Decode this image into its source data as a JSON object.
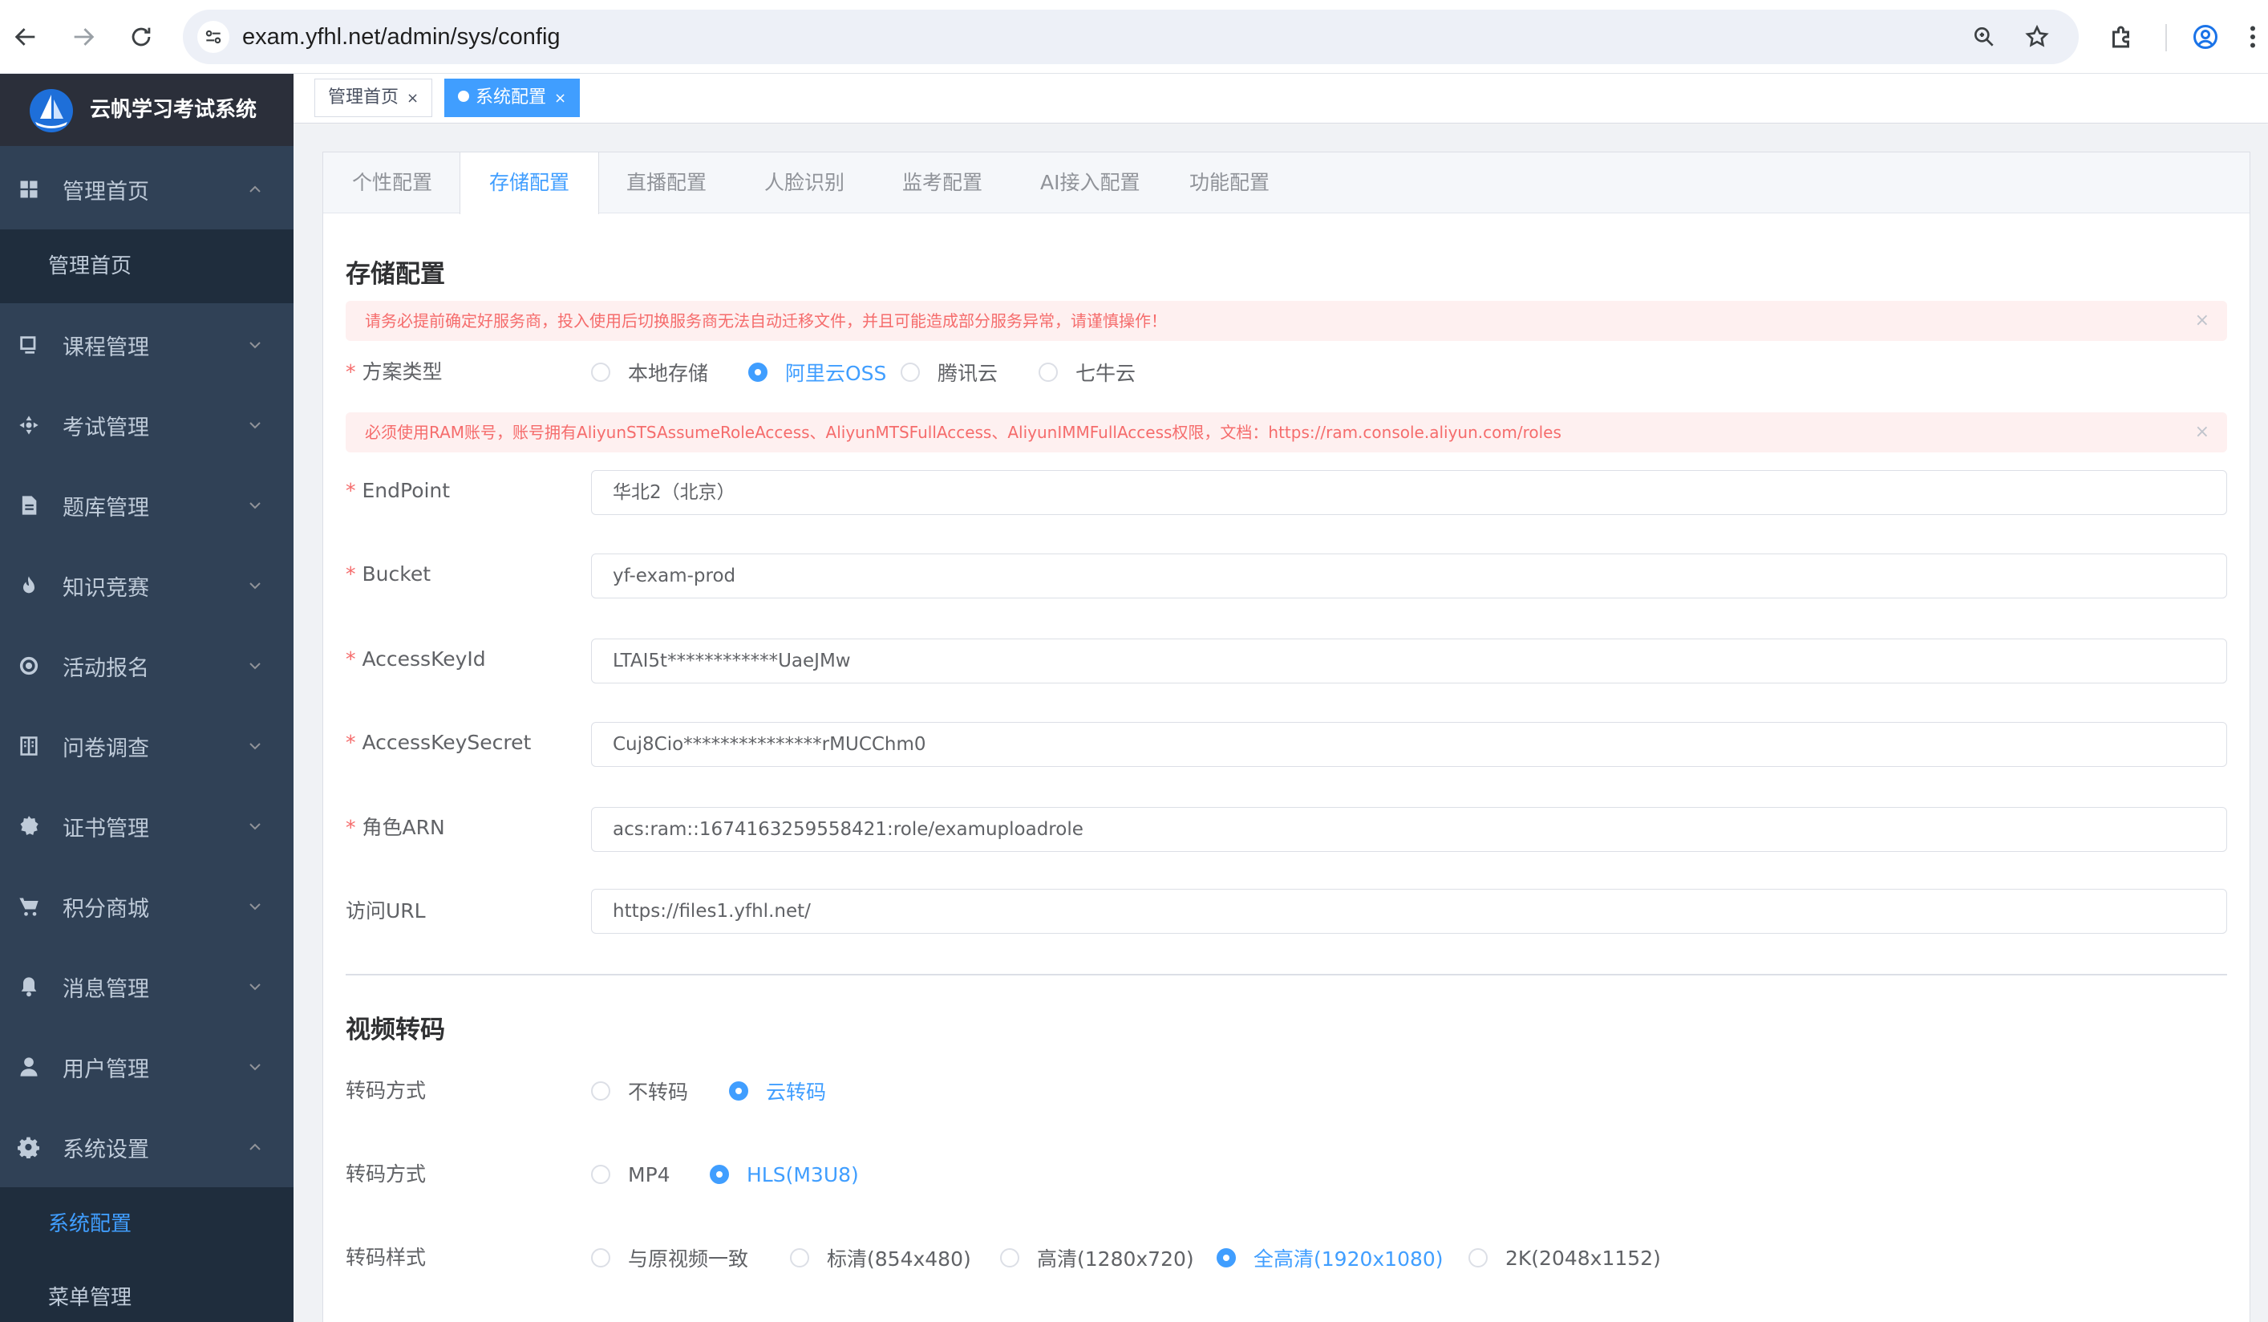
{
  "browser": {
    "url": "exam.yfhl.net/admin/sys/config"
  },
  "sidebar": {
    "app_name": "云帆学习考试系统",
    "menu": [
      {
        "label": "管理首页",
        "icon": "dashboard-icon",
        "expanded": true
      },
      {
        "label": "课程管理",
        "icon": "course-icon",
        "expanded": false
      },
      {
        "label": "考试管理",
        "icon": "exam-icon",
        "expanded": false
      },
      {
        "label": "题库管理",
        "icon": "question-bank-icon",
        "expanded": false
      },
      {
        "label": "知识竞赛",
        "icon": "fire-icon",
        "expanded": false
      },
      {
        "label": "活动报名",
        "icon": "activity-icon",
        "expanded": false
      },
      {
        "label": "问卷调查",
        "icon": "survey-icon",
        "expanded": false
      },
      {
        "label": "证书管理",
        "icon": "certificate-icon",
        "expanded": false
      },
      {
        "label": "积分商城",
        "icon": "cart-icon",
        "expanded": false
      },
      {
        "label": "消息管理",
        "icon": "bell-icon",
        "expanded": false
      },
      {
        "label": "用户管理",
        "icon": "user-icon",
        "expanded": false
      },
      {
        "label": "系统设置",
        "icon": "gear-icon",
        "expanded": true
      }
    ],
    "submenus": {
      "dashboard": [
        "管理首页"
      ],
      "system": [
        "系统配置",
        "菜单管理"
      ]
    }
  },
  "tags": {
    "home": "管理首页",
    "current": "系统配置",
    "close": "×"
  },
  "tabs": [
    "个性配置",
    "存储配置",
    "直播配置",
    "人脸识别",
    "监考配置",
    "AI接入配置",
    "功能配置"
  ],
  "active_tab": "存储配置",
  "storage": {
    "title": "存储配置",
    "warning": "请务必提前确定好服务商，投入使用后切换服务商无法自动迁移文件，并且可能造成部分服务异常，请谨慎操作！",
    "scheme_label": "方案类型",
    "scheme_options": [
      "本地存储",
      "阿里云OSS",
      "腾讯云",
      "七牛云"
    ],
    "scheme_selected": "阿里云OSS",
    "ram_notice": "必须使用RAM账号，账号拥有AliyunSTSAssumeRoleAccess、AliyunMTSFullAccess、AliyunIMMFullAccess权限，文档：https://ram.console.aliyun.com/roles",
    "fields": [
      {
        "label": "EndPoint",
        "value": "华北2（北京）",
        "required": true
      },
      {
        "label": "Bucket",
        "value": "yf-exam-prod",
        "required": true
      },
      {
        "label": "AccessKeyId",
        "value": "LTAI5t************UaeJMw",
        "required": true
      },
      {
        "label": "AccessKeySecret",
        "value": "Cuj8Cio***************rMUCChm0",
        "required": true
      },
      {
        "label": "角色ARN",
        "value": "acs:ram::1674163259558421:role/examuploadrole",
        "required": true
      },
      {
        "label": "访问URL",
        "value": "https://files1.yfhl.net/",
        "required": false
      }
    ],
    "required_mark": "*",
    "close_mark": "×"
  },
  "video": {
    "title": "视频转码",
    "rows": [
      {
        "label": "转码方式",
        "options": [
          "不转码",
          "云转码"
        ],
        "selected": "云转码"
      },
      {
        "label": "转码方式",
        "options": [
          "MP4",
          "HLS(M3U8)"
        ],
        "selected": "HLS(M3U8)"
      },
      {
        "label": "转码样式",
        "options": [
          "与原视频一致",
          "标清(854x480)",
          "高清(1280x720)",
          "全高清(1920x1080)",
          "2K(2048x1152)"
        ],
        "selected": "全高清(1920x1080)"
      }
    ]
  },
  "colors": {
    "primary": "#409eff",
    "danger": "#f56c6c",
    "sidebar_bg": "#304156",
    "sidebar_logo_bg": "#2b2f3a",
    "submenu_bg": "#1f2d3d"
  }
}
